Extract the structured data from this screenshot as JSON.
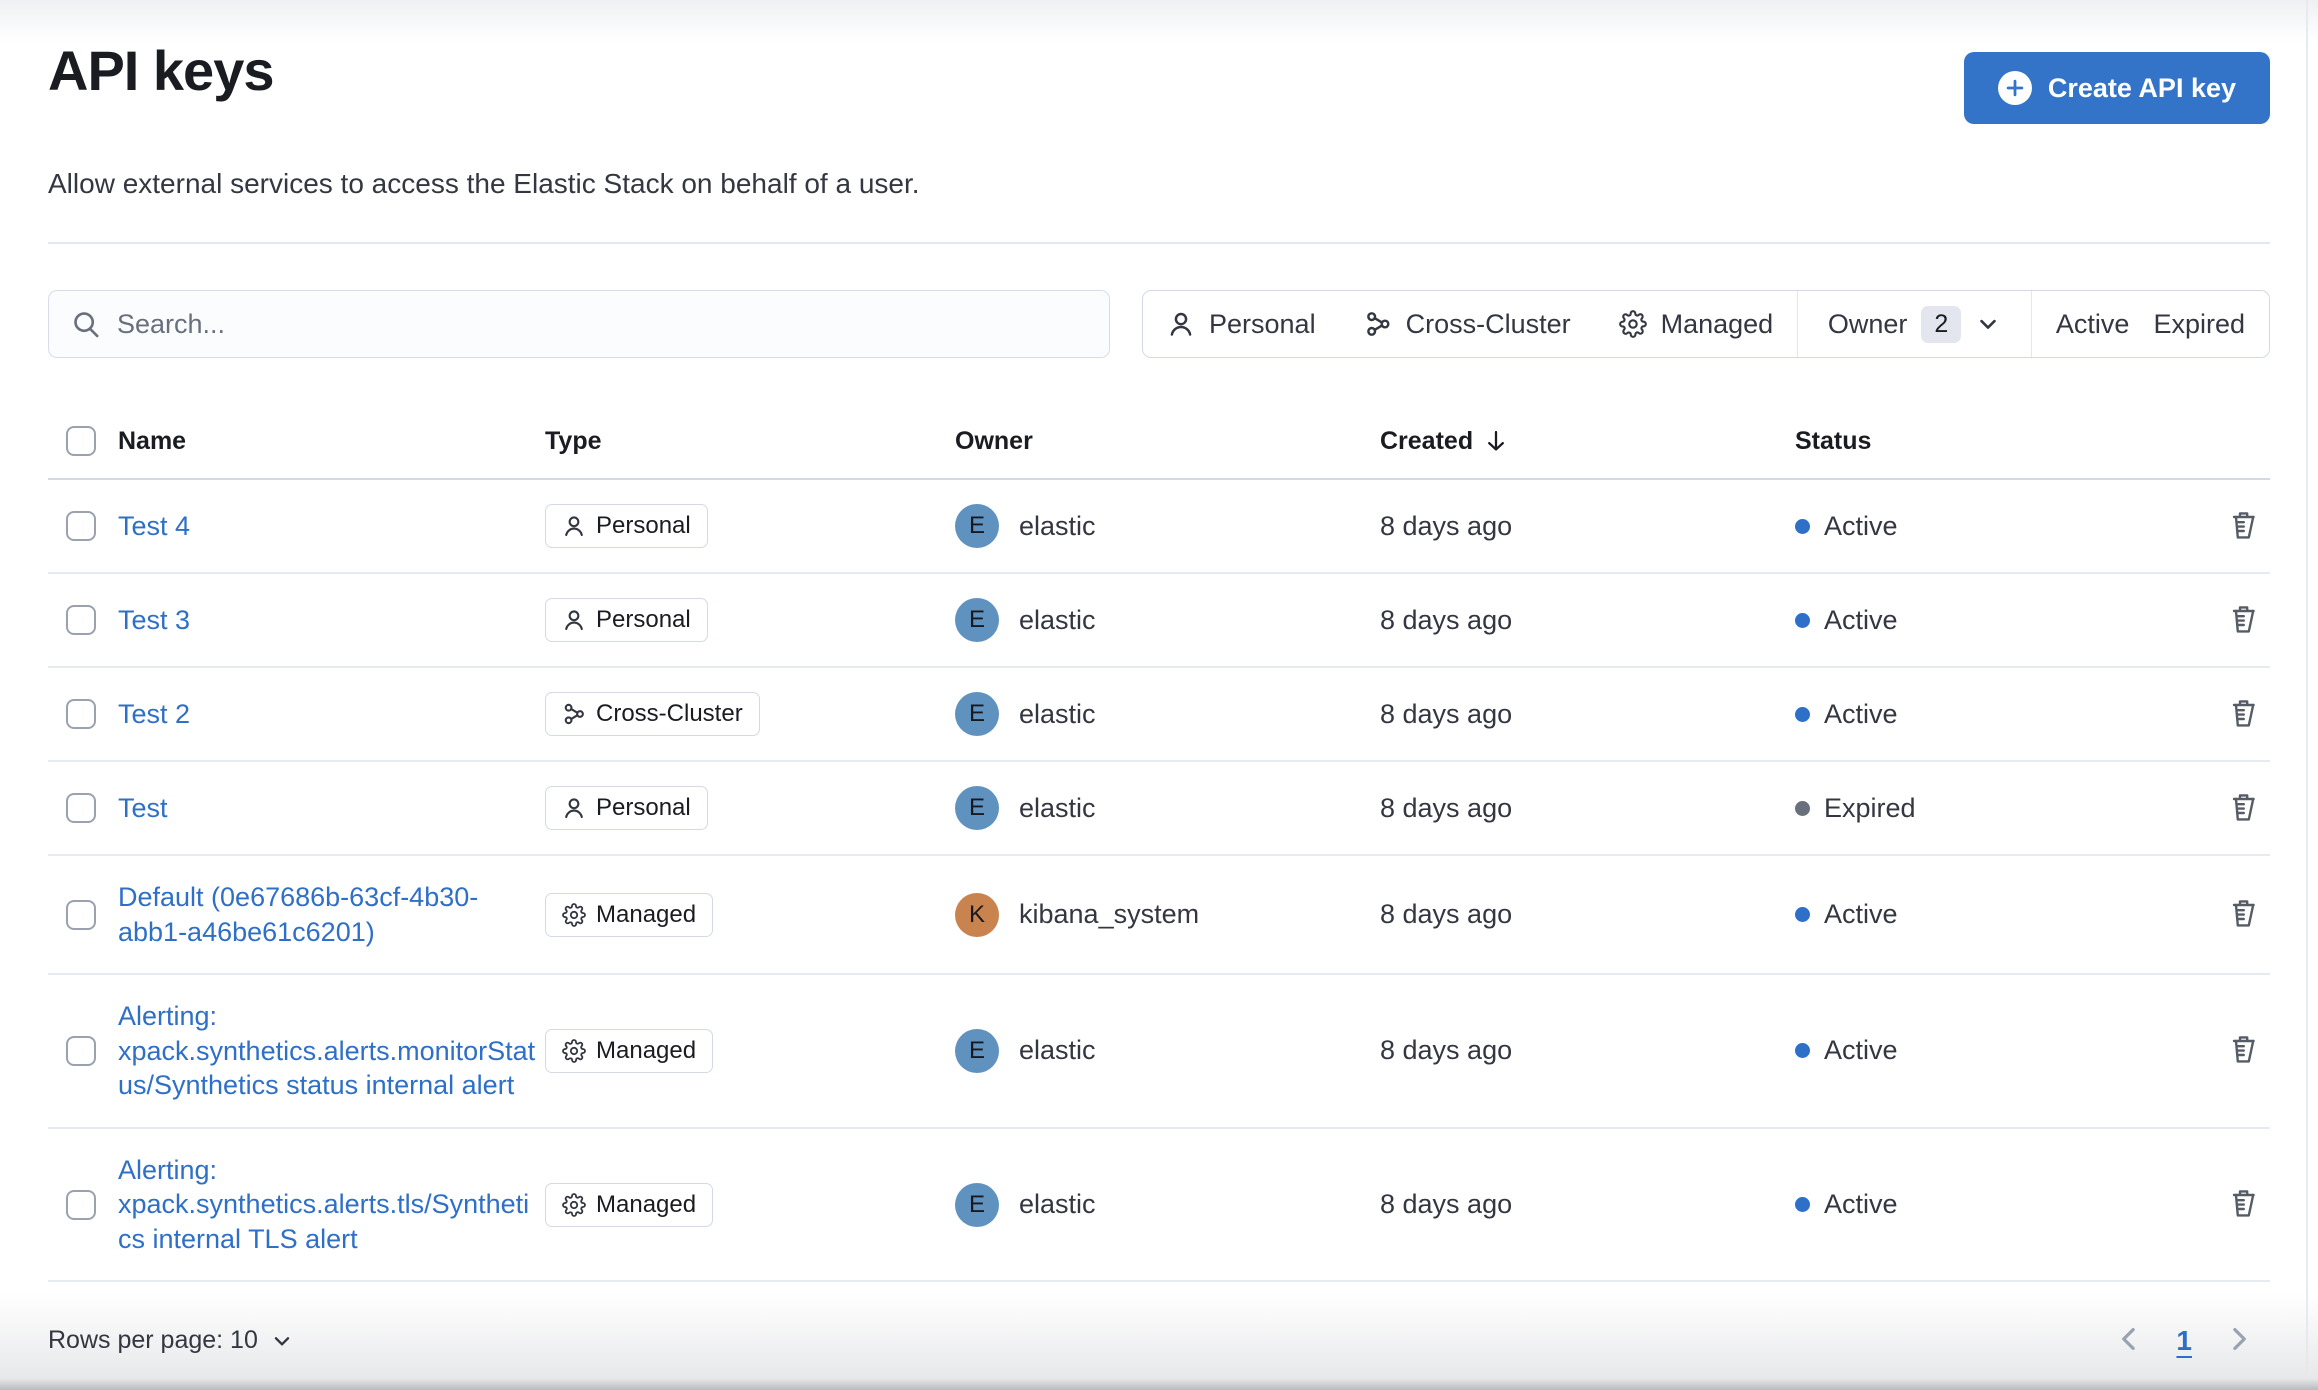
{
  "page": {
    "title": "API keys",
    "description": "Allow external services to access the Elastic Stack on behalf of a user."
  },
  "header": {
    "create_button_label": "Create API key"
  },
  "search": {
    "placeholder": "Search..."
  },
  "filters": {
    "personal_label": "Personal",
    "cross_cluster_label": "Cross-Cluster",
    "managed_label": "Managed",
    "owner_label": "Owner",
    "owner_count": "2",
    "active_label": "Active",
    "expired_label": "Expired"
  },
  "table": {
    "columns": {
      "name": "Name",
      "type": "Type",
      "owner": "Owner",
      "created": "Created",
      "status": "Status"
    },
    "rows": [
      {
        "name": "Test 4",
        "type_label": "Personal",
        "type_icon": "person",
        "owner": "elastic",
        "owner_initial": "E",
        "owner_color": "#6092c0",
        "created": "8 days ago",
        "status": "Active",
        "status_color": "#2e6fc7"
      },
      {
        "name": "Test 3",
        "type_label": "Personal",
        "type_icon": "person",
        "owner": "elastic",
        "owner_initial": "E",
        "owner_color": "#6092c0",
        "created": "8 days ago",
        "status": "Active",
        "status_color": "#2e6fc7"
      },
      {
        "name": "Test 2",
        "type_label": "Cross-Cluster",
        "type_icon": "cluster",
        "owner": "elastic",
        "owner_initial": "E",
        "owner_color": "#6092c0",
        "created": "8 days ago",
        "status": "Active",
        "status_color": "#2e6fc7"
      },
      {
        "name": "Test",
        "type_label": "Personal",
        "type_icon": "person",
        "owner": "elastic",
        "owner_initial": "E",
        "owner_color": "#6092c0",
        "created": "8 days ago",
        "status": "Expired",
        "status_color": "#69707d"
      },
      {
        "name": "Default (0e67686b-63cf-4b30-abb1-a46be61c6201)",
        "type_label": "Managed",
        "type_icon": "gear",
        "owner": "kibana_system",
        "owner_initial": "K",
        "owner_color": "#c9834e",
        "created": "8 days ago",
        "status": "Active",
        "status_color": "#2e6fc7"
      },
      {
        "name": "Alerting: xpack.synthetics.alerts.monitorStatus/Synthetics status internal alert",
        "type_label": "Managed",
        "type_icon": "gear",
        "owner": "elastic",
        "owner_initial": "E",
        "owner_color": "#6092c0",
        "created": "8 days ago",
        "status": "Active",
        "status_color": "#2e6fc7"
      },
      {
        "name": "Alerting: xpack.synthetics.alerts.tls/Synthetics internal TLS alert",
        "type_label": "Managed",
        "type_icon": "gear",
        "owner": "elastic",
        "owner_initial": "E",
        "owner_color": "#6092c0",
        "created": "8 days ago",
        "status": "Active",
        "status_color": "#2e6fc7"
      }
    ]
  },
  "footer": {
    "rows_per_page_label": "Rows per page: 10",
    "current_page": "1"
  },
  "colors": {
    "primary_button": "#3374c9",
    "link_blue": "#2e6fc7",
    "status_active": "#2e6fc7",
    "status_expired": "#69707d",
    "avatar_elastic": "#6092c0",
    "avatar_kibana_system": "#c9834e"
  }
}
